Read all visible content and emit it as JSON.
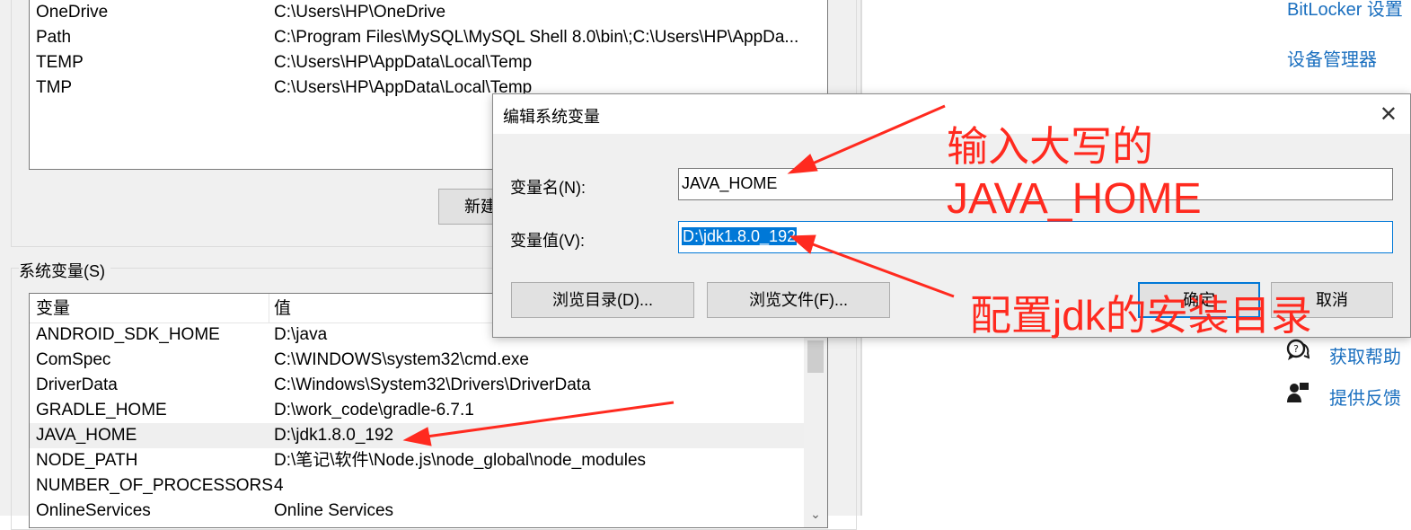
{
  "user_vars": {
    "rows": [
      {
        "name": "OneDrive",
        "value": "C:\\Users\\HP\\OneDrive"
      },
      {
        "name": "Path",
        "value": "C:\\Program Files\\MySQL\\MySQL Shell 8.0\\bin\\;C:\\Users\\HP\\AppDa..."
      },
      {
        "name": "TEMP",
        "value": "C:\\Users\\HP\\AppData\\Local\\Temp"
      },
      {
        "name": "TMP",
        "value": "C:\\Users\\HP\\AppData\\Local\\Temp"
      }
    ],
    "new_button": "新建"
  },
  "system_vars": {
    "group_label": "系统变量(S)",
    "header_name": "变量",
    "header_value": "值",
    "rows": [
      {
        "name": "ANDROID_SDK_HOME",
        "value": "D:\\java"
      },
      {
        "name": "ComSpec",
        "value": "C:\\WINDOWS\\system32\\cmd.exe"
      },
      {
        "name": "DriverData",
        "value": "C:\\Windows\\System32\\Drivers\\DriverData"
      },
      {
        "name": "GRADLE_HOME",
        "value": "D:\\work_code\\gradle-6.7.1"
      },
      {
        "name": "JAVA_HOME",
        "value": "D:\\jdk1.8.0_192"
      },
      {
        "name": "NODE_PATH",
        "value": "D:\\笔记\\软件\\Node.js\\node_global\\node_modules"
      },
      {
        "name": "NUMBER_OF_PROCESSORS",
        "value": "4"
      },
      {
        "name": "OnlineServices",
        "value": "Online Services"
      }
    ],
    "selected_row": "JAVA_HOME"
  },
  "right_pane": {
    "bitlocker_link": "BitLocker 设置",
    "device_manager_link": "设备管理器",
    "help_link": "获取帮助",
    "feedback_link": "提供反馈",
    "help_icon": "chat-help-icon",
    "feedback_icon": "person-feedback-icon"
  },
  "dialog": {
    "title": "编辑系统变量",
    "name_label": "变量名(N):",
    "name_value": "JAVA_HOME",
    "value_label": "变量值(V):",
    "value_value": "D:\\jdk1.8.0_192",
    "browse_dir": "浏览目录(D)...",
    "browse_file": "浏览文件(F)...",
    "ok": "确定",
    "cancel": "取消"
  },
  "annotations": {
    "line1": "输入大写的",
    "line2": "JAVA_HOME",
    "line3": "配置jdk的安装目录",
    "color": "#ff2a1f"
  },
  "colors": {
    "link": "#1a6fbf",
    "accent": "#0078d7"
  }
}
